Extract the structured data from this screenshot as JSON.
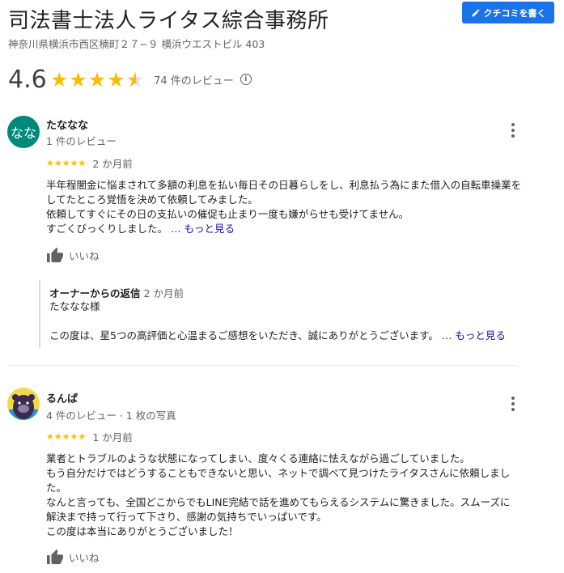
{
  "header": {
    "title": "司法書士法人ライタス綜合事務所",
    "write_review_label": "クチコミを書く",
    "address": "神奈川県横浜市西区楠町２７−９ 横浜ウエストビル 403"
  },
  "rating": {
    "value": "4.6",
    "stars": 4.6,
    "count_label": "74 件のレビュー",
    "info_icon": "info-icon"
  },
  "reviews": [
    {
      "avatar_text": "なな",
      "name": "たななな",
      "meta": "1 件のレビュー",
      "stars": "★★★★★",
      "rating": 5,
      "time": "2 か月前",
      "lines": [
        "半年程闇金に悩まされて多額の利息を払い毎日その日暮らしをし、利息払う為にまた借入の自転車操業を",
        "してたところ覚悟を決めて依頼してみました。",
        "依頼してすぐにその日の支払いの催促も止まり一度も嫌がらせも受けてません。",
        "すごくびっくりしました。"
      ],
      "ellipsis": "…",
      "more_label": "もっと見る",
      "like_label": "いいね",
      "reply": {
        "owner_label": "オーナーからの返信",
        "time": "2 か月前",
        "line1": "たななな様",
        "line2": "この度は、星5つの高評価と心温まるご感想をいただき、誠にありがとうございます。",
        "ellipsis": "…",
        "more_label": "もっと見る"
      }
    },
    {
      "name": "るんぱ",
      "meta": "4 件のレビュー · 1 枚の写真",
      "stars": "★★★★★",
      "rating": 5,
      "time": "1 か月前",
      "lines": [
        "業者とトラブルのような状態になってしまい、度々くる連絡に怯えながら過ごしていました。",
        "もう自分だけではどうすることもできないと思い、ネットで調べて見つけたライタスさんに依頼しまし",
        "た。",
        "なんと言っても、全国どこからでもLINE完結で話を進めてもらえるシステムに驚きました。スムーズに",
        "解決まで持って行って下さり、感謝の気持ちでいっぱいです。",
        "この度は本当にありがとうございました！"
      ],
      "like_label": "いいね"
    }
  ]
}
